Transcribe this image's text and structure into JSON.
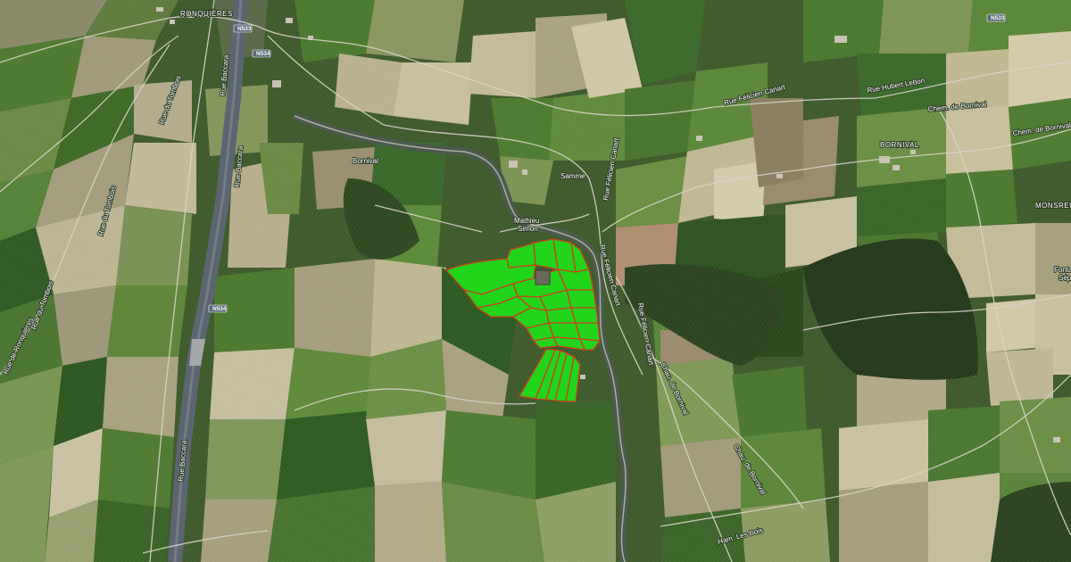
{
  "map": {
    "view": "satellite",
    "colors": {
      "parcel_fill": "#22d41a",
      "parcel_stroke": "#c8401e",
      "road": "#d8d4c8",
      "canal": "#5c6670",
      "forest": "#2b3d1f"
    },
    "places": [
      {
        "id": "ronquieres",
        "text": "RONQUIÈRES"
      },
      {
        "id": "bornival",
        "text": "BORNIVAL"
      },
      {
        "id": "monstreux",
        "text": "MONSREUX"
      },
      {
        "id": "bornival-hamlet",
        "text": "Bornival"
      },
      {
        "id": "samme",
        "text": "Samme"
      },
      {
        "id": "mathieu",
        "text": "Mathieu"
      },
      {
        "id": "simon",
        "text": "Simon"
      },
      {
        "id": "fonts",
        "text": "Fonta"
      },
      {
        "id": "sep",
        "text": "Sép"
      }
    ],
    "roads": [
      {
        "id": "n533-a",
        "text": "N533"
      },
      {
        "id": "n534-a",
        "text": "N534"
      },
      {
        "id": "n534-b",
        "text": "N534"
      },
      {
        "id": "n533-b",
        "text": "N533"
      },
      {
        "id": "rue-tombois-1",
        "text": "Rue du Tombois"
      },
      {
        "id": "rue-tombois-2",
        "text": "Rue du Tombois"
      },
      {
        "id": "rue-tombois-3",
        "text": "Rue du Tombois"
      },
      {
        "id": "rue-ronquieres",
        "text": "Rue de Ronquières"
      },
      {
        "id": "rue-baccara-1",
        "text": "Rue Baccara"
      },
      {
        "id": "rue-baccara-2",
        "text": "Rue Baccara"
      },
      {
        "id": "rue-baccara-3",
        "text": "Rue Baccara"
      },
      {
        "id": "rue-felicien-1",
        "text": "Rue Félicien Canart"
      },
      {
        "id": "rue-felicien-2",
        "text": "Rue Félicien Canart"
      },
      {
        "id": "rue-felicien-3",
        "text": "Rue Félicien Canart"
      },
      {
        "id": "rue-felicien-4",
        "text": "Rue Félicien Canart"
      },
      {
        "id": "rue-hubert",
        "text": "Rue Hubert Lebon"
      },
      {
        "id": "chem-bornival-1",
        "text": "Chem. de Bornival"
      },
      {
        "id": "chem-bornival-2",
        "text": "Chem. de Bornival"
      },
      {
        "id": "chau-bornival-1",
        "text": "Chau. de Bornival"
      },
      {
        "id": "chau-bornival-2",
        "text": "Chau. de Bornival"
      },
      {
        "id": "ham-les-bois",
        "text": "Ham. Les Bois"
      }
    ]
  }
}
